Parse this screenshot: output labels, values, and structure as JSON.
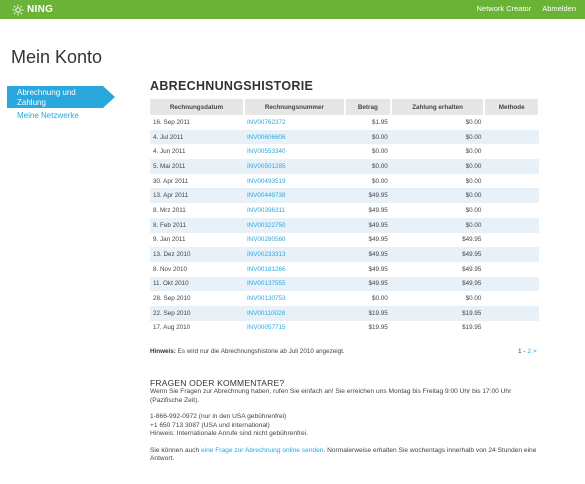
{
  "header": {
    "logo_text": "NING",
    "nav": [
      "Network Creator",
      "Abmelden"
    ],
    "accent_color": "#6ab336"
  },
  "page_title": "Mein Konto",
  "sidebar": {
    "active_label": "Abrechnung und Zahlung",
    "items": [
      "Meine Netzwerke"
    ],
    "active_color": "#2aa7dd"
  },
  "billing": {
    "title": "ABRECHNUNGSHISTORIE",
    "columns": [
      "Rechnungsdatum",
      "Rechnungsnummer",
      "Betrag",
      "Zahlung erhalten",
      "Methode"
    ],
    "rows": [
      [
        "16. Sep 2011",
        "INV00762372",
        "$1.95",
        "$0.00",
        ""
      ],
      [
        "4. Jul 2011",
        "INV00606606",
        "$0.00",
        "$0.00",
        ""
      ],
      [
        "4. Jun 2011",
        "INV00553340",
        "$0.00",
        "$0.00",
        ""
      ],
      [
        "5. Mai 2011",
        "INV00501285",
        "$0.00",
        "$0.00",
        ""
      ],
      [
        "30. Apr 2011",
        "INV00493519",
        "$0.00",
        "$0.00",
        ""
      ],
      [
        "13. Apr 2011",
        "INV00449738",
        "$49.95",
        "$0.00",
        ""
      ],
      [
        "8. Mrz 2011",
        "INV00396311",
        "$49.95",
        "$0.00",
        ""
      ],
      [
        "8. Feb 2011",
        "INV00322750",
        "$49.95",
        "$0.00",
        ""
      ],
      [
        "9. Jan 2011",
        "INV00280560",
        "$49.95",
        "$49.95",
        ""
      ],
      [
        "13. Dez 2010",
        "INV00233313",
        "$49.95",
        "$49.95",
        ""
      ],
      [
        "8. Nov 2010",
        "INV00181266",
        "$49.95",
        "$49.95",
        ""
      ],
      [
        "11. Okt 2010",
        "INV00137555",
        "$49.95",
        "$49.95",
        ""
      ],
      [
        "28. Sep 2010",
        "INV00130753",
        "$0.00",
        "$0.00",
        ""
      ],
      [
        "22. Sep 2010",
        "INV00110028",
        "$19.95",
        "$19.95",
        ""
      ],
      [
        "17. Aug 2010",
        "INV00057715",
        "$19.95",
        "$19.95",
        ""
      ]
    ],
    "hint_label": "Hinweis:",
    "hint_text": " Es wird nur die Abrechnungshistorie ab Juli 2010 angezeigt.",
    "pager": {
      "current": "1",
      "sep": " - ",
      "next_page": "2",
      "next_arrow": " >"
    }
  },
  "faq": {
    "title": "FRAGEN ODER KOMMENTARE?",
    "intro": "Wenn Sie Fragen zur Abrechnung haben, rufen Sie einfach an! Sie erreichen uns Montag bis Freitag 9:00 Uhr bis 17:00 Uhr (Pazifische Zeit).",
    "phone1": "1-866-992-0972 (nur in den USA gebührenfrei)",
    "phone2": "+1 650 713 3087 (USA und international)",
    "phone_hint": "Hinweis: Internationale Anrufe sind nicht gebührenfrei.",
    "online_prefix": "Sie können auch ",
    "online_link": "eine Frage zur Abrechnung online senden",
    "online_suffix": ". Normalerweise erhalten Sie wochentags innerhalb von 24 Stunden eine Antwort."
  }
}
